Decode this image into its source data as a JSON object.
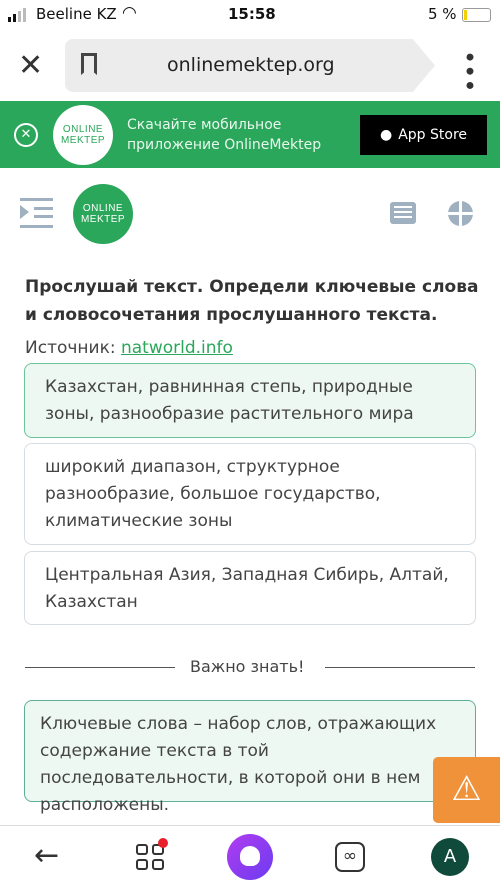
{
  "status_bar": {
    "carrier": "Beeline KZ",
    "time": "15:58",
    "battery": "5 %"
  },
  "browser": {
    "url": "onlinemektep.org"
  },
  "banner": {
    "logo_line1": "ONLINE",
    "logo_line2": "MEKTEP",
    "text_line1": "Скачайте мобильное",
    "text_line2": "приложение OnlineMektep",
    "app_store_label": "App Store"
  },
  "header": {
    "logo_line1": "ONLINE",
    "logo_line2": "MEKTEP"
  },
  "task": {
    "title": "Прослушай текст. Определи ключевые слова и словосочетания прослушанного текста.",
    "source_label": "Источник:",
    "source_link": "natworld.info"
  },
  "options": [
    {
      "text": "Казахстан, равнинная степь, природные зоны, разнообразие растительного мира",
      "selected": true
    },
    {
      "text": "широкий диапазон, структурное разнообразие, большое государство, климатические зоны",
      "selected": false
    },
    {
      "text": "Центральная Азия, Западная Сибирь, Алтай, Казахстан",
      "selected": false
    }
  ],
  "important": {
    "label": "Важно знать!",
    "text": "Ключевые слова – набор слов, отражающих содержание текста в той последовательности, в которой они в нем расположены."
  },
  "bottom_nav": {
    "avatar_letter": "A"
  },
  "colors": {
    "green": "#2aa75a",
    "orange": "#f0923a",
    "alice": "#8a3cf0",
    "avatar": "#0f4a3a"
  }
}
